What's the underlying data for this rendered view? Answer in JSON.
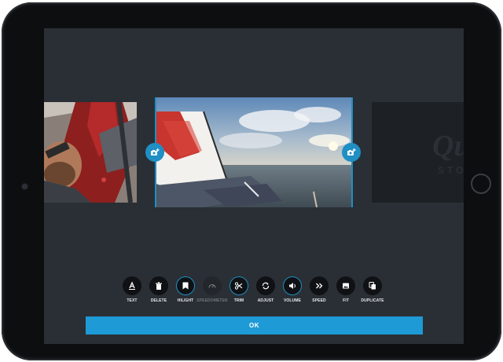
{
  "brand": {
    "ghost_text": "Qui",
    "ghost_sub": "STO"
  },
  "toolbar": {
    "tools": [
      {
        "label": "TEXT",
        "icon": "text-icon"
      },
      {
        "label": "DELETE",
        "icon": "trash-icon"
      },
      {
        "label": "HILIGHT",
        "icon": "highlight-tag-icon",
        "selected": true
      },
      {
        "label": "SPEEDOMETER",
        "icon": "speedometer-icon",
        "disabled": true
      },
      {
        "label": "TRIM",
        "icon": "scissors-icon",
        "selected": true
      },
      {
        "label": "ADJUST",
        "icon": "rotate-icon"
      },
      {
        "label": "VOLUME",
        "icon": "speaker-icon",
        "selected": true
      },
      {
        "label": "SPEED",
        "icon": "fast-forward-icon"
      },
      {
        "label": "FIT",
        "icon": "image-fit-icon"
      },
      {
        "label": "DUPLICATE",
        "icon": "duplicate-icon"
      }
    ]
  },
  "ok_button": {
    "label": "OK"
  },
  "colors": {
    "accent": "#1e9ad6",
    "screen_bg": "#2a2f35",
    "button_bg": "#0f1114"
  }
}
